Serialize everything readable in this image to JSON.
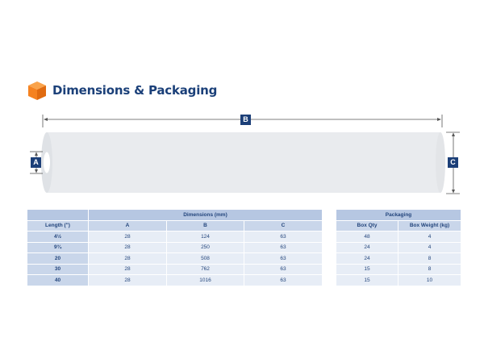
{
  "header": {
    "title": "Dimensions & Packaging",
    "icon": "box-icon",
    "icon_color": "#f58220"
  },
  "diagram": {
    "label_a": "A",
    "label_b": "B",
    "label_c": "C"
  },
  "dimensions_table": {
    "group_header": "Dimensions (mm)",
    "columns": [
      "Length (\")",
      "A",
      "B",
      "C"
    ],
    "rows": [
      [
        "4½",
        "28",
        "124",
        "63"
      ],
      [
        "9¾",
        "28",
        "250",
        "63"
      ],
      [
        "20",
        "28",
        "508",
        "63"
      ],
      [
        "30",
        "28",
        "762",
        "63"
      ],
      [
        "40",
        "28",
        "1016",
        "63"
      ]
    ]
  },
  "packaging_table": {
    "group_header": "Packaging",
    "columns": [
      "Box Qty",
      "Box Weight (kg)"
    ],
    "rows": [
      [
        "48",
        "4"
      ],
      [
        "24",
        "4"
      ],
      [
        "24",
        "8"
      ],
      [
        "15",
        "8"
      ],
      [
        "15",
        "10"
      ]
    ]
  },
  "colors": {
    "brand_blue": "#1c3f78",
    "header_blue": "#b6c7e2",
    "cell_blue": "#e7edf6"
  }
}
